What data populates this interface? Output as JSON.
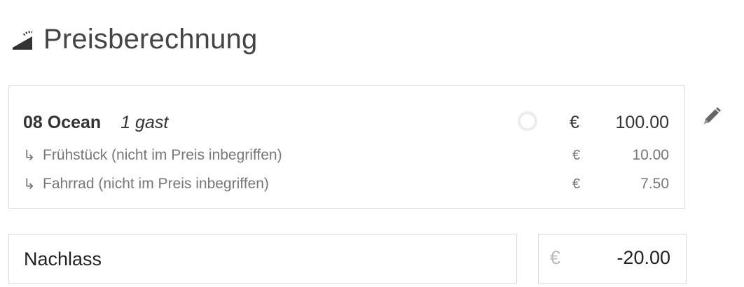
{
  "header": {
    "title": "Preisberechnung",
    "icon": "calculator-icon"
  },
  "room": {
    "name": "08 Ocean",
    "guests": "1 gast",
    "currency": "€",
    "amount": "100.00",
    "extras": [
      {
        "arrow": "↳",
        "label": "Frühstück (nicht im Preis inbegriffen)",
        "currency": "€",
        "amount": "10.00"
      },
      {
        "arrow": "↳",
        "label": "Fahrrad (nicht im Preis inbegriffen)",
        "currency": "€",
        "amount": "7.50"
      }
    ]
  },
  "discount": {
    "label": "Nachlass",
    "currency": "€",
    "amount": "-20.00"
  },
  "colors": {
    "border": "#d9d9d9",
    "muted_text": "#777777",
    "circle": "#ececec"
  }
}
